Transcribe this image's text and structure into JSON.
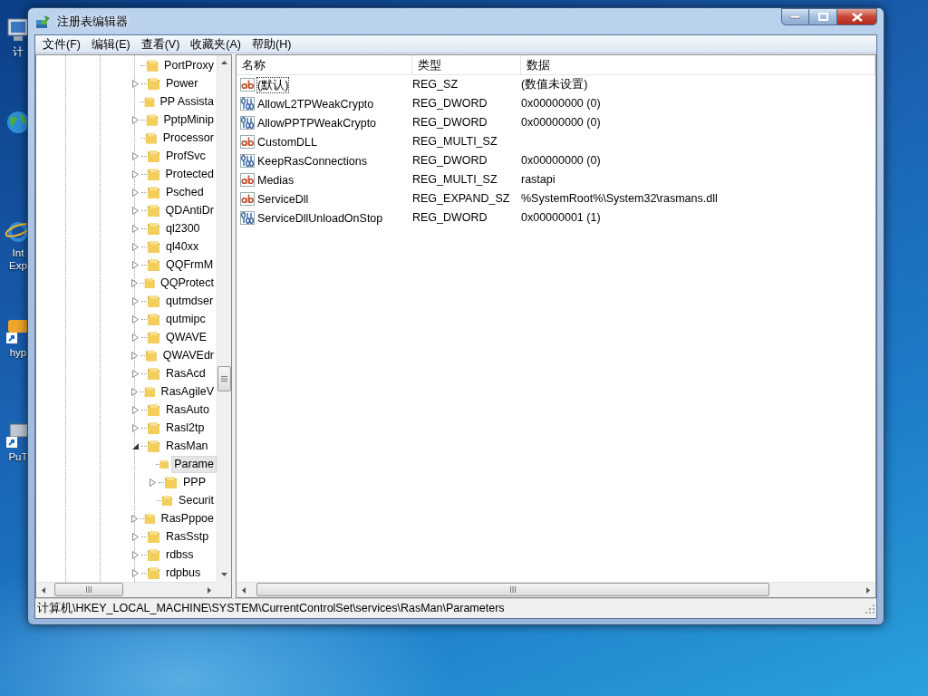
{
  "desktop_icons": [
    {
      "kind": "computer",
      "lines": [
        "计"
      ]
    },
    {
      "kind": "globe"
    },
    {
      "kind": "browser",
      "lines": [
        "Int",
        "Exp"
      ]
    },
    {
      "kind": "shortcut",
      "lines": [
        "hyp"
      ]
    },
    {
      "kind": "shortcut2",
      "lines": [
        "PuT"
      ]
    }
  ],
  "window": {
    "title": "注册表编辑器"
  },
  "menu": [
    "文件(F)",
    "编辑(E)",
    "查看(V)",
    "收藏夹(A)",
    "帮助(H)"
  ],
  "tree": [
    {
      "label": "PortProxy",
      "kind": "leaf",
      "selected": false
    },
    {
      "label": "Power",
      "kind": "node",
      "expanded": false,
      "selected": false
    },
    {
      "label": "PP Assista",
      "kind": "leaf",
      "selected": false
    },
    {
      "label": "PptpMinip",
      "kind": "node",
      "expanded": false,
      "selected": false
    },
    {
      "label": "Processor",
      "kind": "leaf",
      "selected": false
    },
    {
      "label": "ProfSvc",
      "kind": "node",
      "expanded": false,
      "selected": false
    },
    {
      "label": "Protected",
      "kind": "node",
      "expanded": false,
      "selected": false
    },
    {
      "label": "Psched",
      "kind": "node",
      "expanded": false,
      "selected": false
    },
    {
      "label": "QDAntiDr",
      "kind": "node",
      "expanded": false,
      "selected": false
    },
    {
      "label": "ql2300",
      "kind": "node",
      "expanded": false,
      "selected": false
    },
    {
      "label": "ql40xx",
      "kind": "node",
      "expanded": false,
      "selected": false
    },
    {
      "label": "QQFrmM",
      "kind": "node",
      "expanded": false,
      "selected": false
    },
    {
      "label": "QQProtect",
      "kind": "node",
      "expanded": false,
      "selected": false
    },
    {
      "label": "qutmdser",
      "kind": "node",
      "expanded": false,
      "selected": false
    },
    {
      "label": "qutmipc",
      "kind": "node",
      "expanded": false,
      "selected": false
    },
    {
      "label": "QWAVE",
      "kind": "node",
      "expanded": false,
      "selected": false
    },
    {
      "label": "QWAVEdr",
      "kind": "node",
      "expanded": false,
      "selected": false
    },
    {
      "label": "RasAcd",
      "kind": "node",
      "expanded": false,
      "selected": false
    },
    {
      "label": "RasAgileV",
      "kind": "node",
      "expanded": false,
      "selected": false
    },
    {
      "label": "RasAuto",
      "kind": "node",
      "expanded": false,
      "selected": false
    },
    {
      "label": "Rasl2tp",
      "kind": "node",
      "expanded": false,
      "selected": false
    },
    {
      "label": "RasMan",
      "kind": "node",
      "expanded": true,
      "selected": false,
      "children": [
        {
          "label": "Parame",
          "kind": "leaf",
          "selected": true
        },
        {
          "label": "PPP",
          "kind": "node",
          "expanded": false,
          "selected": false
        },
        {
          "label": "Securit",
          "kind": "leaf",
          "selected": false
        }
      ]
    },
    {
      "label": "RasPppoe",
      "kind": "node",
      "expanded": false,
      "selected": false
    },
    {
      "label": "RasSstp",
      "kind": "node",
      "expanded": false,
      "selected": false
    },
    {
      "label": "rdbss",
      "kind": "node",
      "expanded": false,
      "selected": false
    },
    {
      "label": "rdpbus",
      "kind": "node",
      "expanded": false,
      "selected": false
    }
  ],
  "table": {
    "columns": [
      "名称",
      "类型",
      "数据"
    ],
    "rows": [
      {
        "kind": "string",
        "name": "(默认)",
        "type": "REG_SZ",
        "data": "(数值未设置)",
        "selected": true
      },
      {
        "kind": "binary",
        "name": "AllowL2TPWeakCrypto",
        "type": "REG_DWORD",
        "data": "0x00000000 (0)",
        "selected": false
      },
      {
        "kind": "binary",
        "name": "AllowPPTPWeakCrypto",
        "type": "REG_DWORD",
        "data": "0x00000000 (0)",
        "selected": false
      },
      {
        "kind": "string",
        "name": "CustomDLL",
        "type": "REG_MULTI_SZ",
        "selected": false
      },
      {
        "kind": "binary",
        "name": "KeepRasConnections",
        "type": "REG_DWORD",
        "data": "0x00000000 (0)",
        "selected": false
      },
      {
        "kind": "string",
        "name": "Medias",
        "type": "REG_MULTI_SZ",
        "data": "rastapi",
        "selected": false
      },
      {
        "kind": "string",
        "name": "ServiceDll",
        "type": "REG_EXPAND_SZ",
        "data": "%SystemRoot%\\System32\\rasmans.dll",
        "selected": false
      },
      {
        "kind": "binary",
        "name": "ServiceDllUnloadOnStop",
        "type": "REG_DWORD",
        "data": "0x00000001 (1)",
        "selected": false
      }
    ]
  },
  "status_bar": "计算机\\HKEY_LOCAL_MACHINE\\SYSTEM\\CurrentControlSet\\services\\RasMan\\Parameters"
}
